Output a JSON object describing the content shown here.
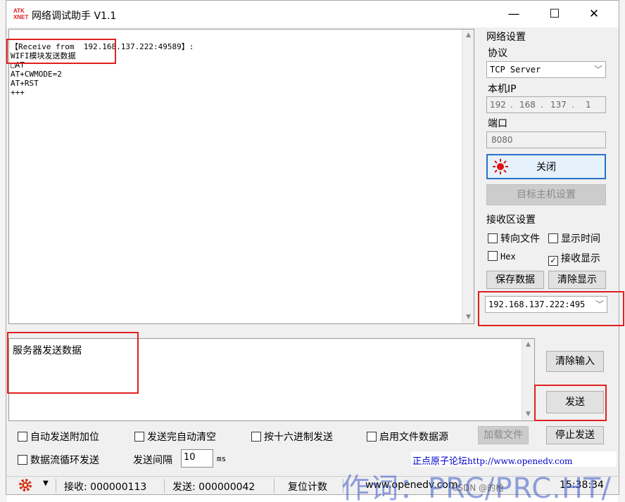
{
  "title": "网络调试助手 V1.1",
  "logo": {
    "line1": "ATK",
    "line2": "XNET"
  },
  "window_buttons": {
    "min": "—",
    "max": "☐",
    "close": "✕"
  },
  "receive": {
    "lines": "【Receive from  192.168.137.222:49589】:\nWIFI模块发送数据\n□AT\nAT+CWMODE=2\nAT+RST\n+++"
  },
  "network": {
    "group_title": "网络设置",
    "protocol_label": "协议",
    "protocol_value": "TCP Server",
    "ip_label": "本机IP",
    "ip": [
      "192",
      "168",
      "137",
      "1"
    ],
    "port_label": "端口",
    "port_value": "8080",
    "close_button": "关闭",
    "target_button": "目标主机设置"
  },
  "recv_settings": {
    "group_title": "接收区设置",
    "redirect_file": "转向文件",
    "show_time": "显示时间",
    "hex": "Hex",
    "recv_show": "接收显示",
    "save_button": "保存数据",
    "clear_display_button": "清除显示",
    "client_select": "192.168.137.222:495"
  },
  "send": {
    "text": "服务器发送数据",
    "clear_input_button": "清除输入",
    "send_button": "发送"
  },
  "options": {
    "auto_append": "自动发送附加位",
    "auto_clear": "发送完自动清空",
    "hex_send": "按十六进制发送",
    "file_source": "启用文件数据源",
    "load_file_button": "加载文件",
    "stop_send_button": "停止发送",
    "loop_send": "数据流循环发送",
    "interval_label": "发送间隔",
    "interval_value": "10",
    "interval_unit": "ms",
    "forum_label": "正点原子论坛",
    "forum_url": "http://www.openedv.com"
  },
  "status": {
    "recv": "接收: 000000113",
    "sent": "发送: 000000042",
    "reset": "复位计数",
    "site": "www.openedv.com",
    "time": "15:38:34"
  },
  "watermark": "作词：PRC/PRC.HT/",
  "csdn_mark": "CSDN @的枪"
}
